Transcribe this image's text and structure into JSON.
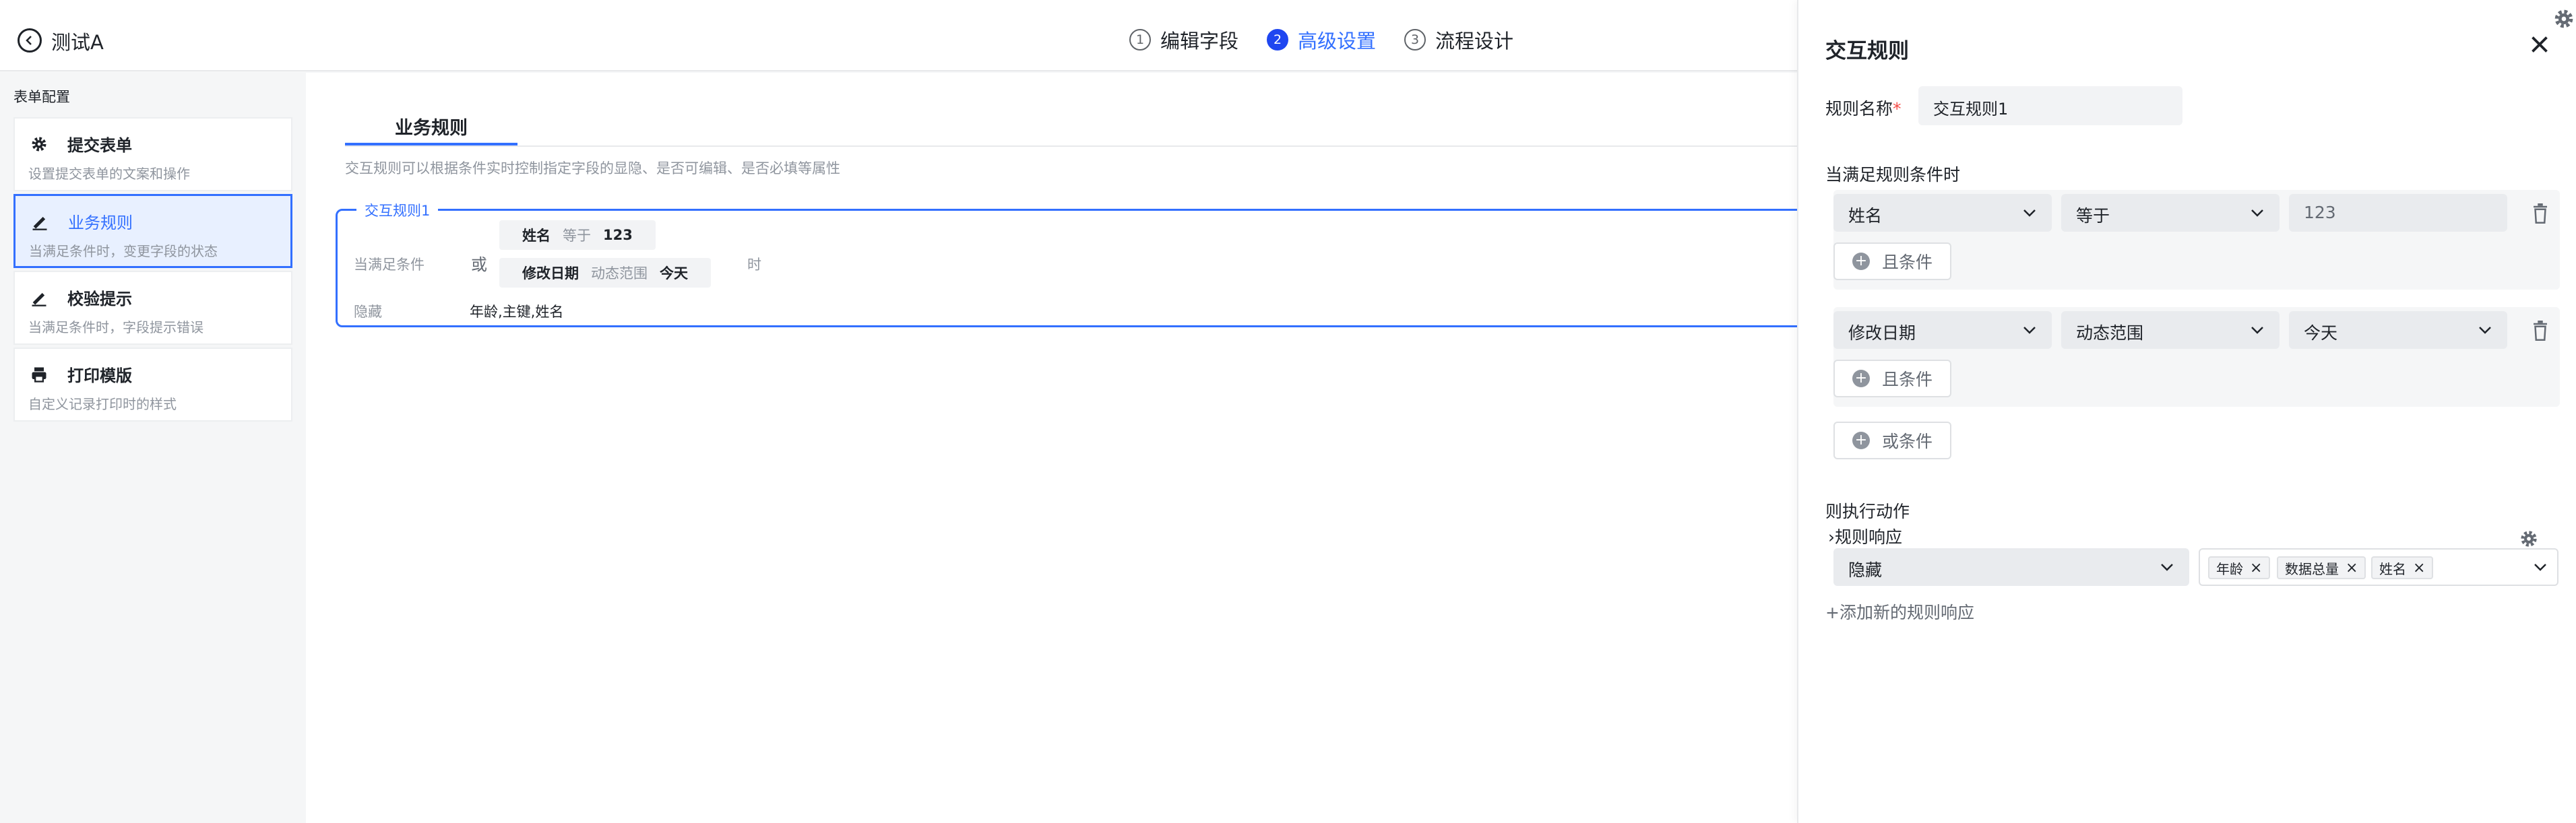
{
  "header": {
    "app_title": "测试A",
    "steps": [
      {
        "num": "1",
        "label": "编辑字段"
      },
      {
        "num": "2",
        "label": "高级设置"
      },
      {
        "num": "3",
        "label": "流程设计"
      }
    ],
    "active_step": 2
  },
  "sidebar": {
    "title": "表单配置",
    "items": [
      {
        "icon": "gear-icon",
        "title": "提交表单",
        "desc": "设置提交表单的文案和操作"
      },
      {
        "icon": "pen-icon",
        "title": "业务规则",
        "desc": "当满足条件时，变更字段的状态"
      },
      {
        "icon": "pen-icon",
        "title": "校验提示",
        "desc": "当满足条件时，字段提示错误"
      },
      {
        "icon": "printer-icon",
        "title": "打印模版",
        "desc": "自定义记录打印时的样式"
      }
    ],
    "active_item": 1
  },
  "main": {
    "tab_label": "业务规则",
    "description": "交互规则可以根据条件实时控制指定字段的显隐、是否可编辑、是否必填等属性",
    "rule_card": {
      "name": "交互规则1",
      "condition_label": "当满足条件",
      "or_label": "或",
      "when_label": "时",
      "conditions": [
        {
          "field": "姓名",
          "op": "等于",
          "value": "123"
        },
        {
          "field": "修改日期",
          "op": "动态范围",
          "value": "今天"
        }
      ],
      "action_label": "隐藏",
      "action_fields": "年龄,主键,姓名"
    }
  },
  "panel": {
    "title": "交互规则",
    "name_label": "规则名称",
    "required_mark": "*",
    "name_value": "交互规则1",
    "conditions_heading": "当满足规则条件时",
    "condition_groups": [
      {
        "field": "姓名",
        "op": "等于",
        "value": "123",
        "and_label": "且条件"
      },
      {
        "field": "修改日期",
        "op": "动态范围",
        "value": "今天",
        "and_label": "且条件"
      }
    ],
    "or_button": "或条件",
    "actions_heading": "则执行动作",
    "response_heading": "规则响应",
    "action_select": "隐藏",
    "action_tags": [
      "年龄",
      "数据总量",
      "姓名"
    ],
    "add_response": "+添加新的规则响应"
  }
}
